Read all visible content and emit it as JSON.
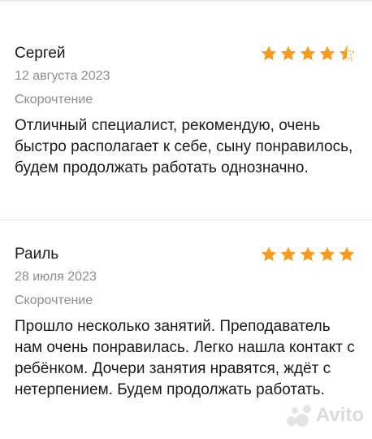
{
  "reviews": [
    {
      "author": "Сергей",
      "date": "12 августа 2023",
      "service": "Скорочтение",
      "rating": 4.5,
      "text": "Отличный специалист, рекомендую, очень быстро располагает к себе, сыну понравилось, будем продолжать работать однозначно."
    },
    {
      "author": "Раиль",
      "date": "28 июля 2023",
      "service": "Скорочтение",
      "rating": 5,
      "text": "Прошло несколько занятий. Преподаватель нам очень понравилась. Легко нашла контакт с ребёнком. Дочери занятия нравятся, ждёт с нетерпением. Будем продолжать работать."
    }
  ],
  "watermark": {
    "text": "Avito"
  },
  "colors": {
    "star": "#f79a1d",
    "star_empty": "#e4e4e4",
    "muted": "#8c8c8c"
  }
}
